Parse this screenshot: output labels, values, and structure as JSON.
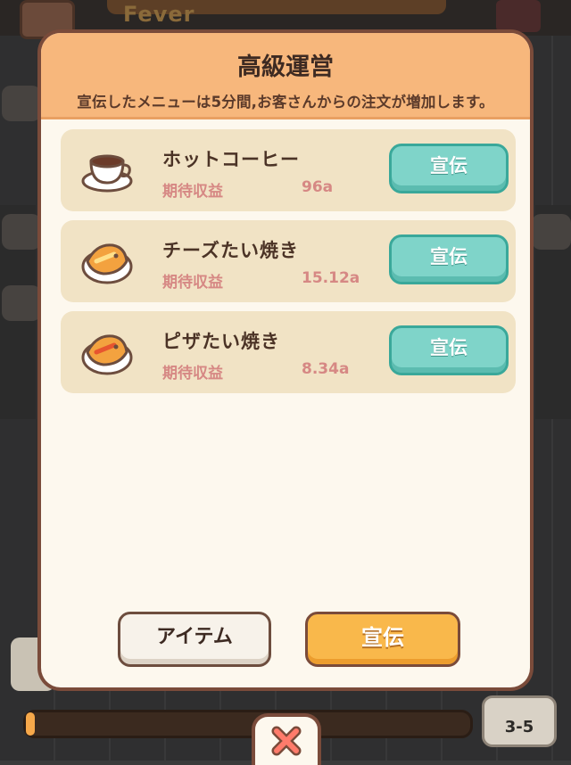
{
  "background": {
    "fever_label": "Fever",
    "level_label": "3-5",
    "progress": 0.02
  },
  "modal": {
    "title": "高級運営",
    "subtitle": "宣伝したメニューは5分間,お客さんからの注文が増加します。",
    "items": [
      {
        "name": "ホットコーヒー",
        "income_label": "期待収益",
        "income_value": "96a",
        "button": "宣伝",
        "icon": "coffee-cup-icon"
      },
      {
        "name": "チーズたい焼き",
        "income_label": "期待収益",
        "income_value": "15.12a",
        "button": "宣伝",
        "icon": "taiyaki-icon"
      },
      {
        "name": "ピザたい焼き",
        "income_label": "期待収益",
        "income_value": "8.34a",
        "button": "宣伝",
        "icon": "taiyaki-icon"
      }
    ],
    "item_button": "アイテム",
    "promo_button": "宣伝"
  },
  "colors": {
    "header": "#f7b77c",
    "panel": "#fdf8ee",
    "row": "#f1e3c5",
    "teal_button": "#7fd4c9",
    "orange_button": "#f9b84b",
    "income_text": "#d68884",
    "border": "#7a4b3a"
  }
}
